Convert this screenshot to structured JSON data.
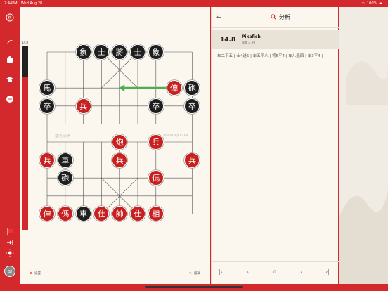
{
  "status": {
    "time": "7:44PM",
    "date": "Wed Aug 28",
    "battery": "100%"
  },
  "colors": {
    "accent": "#d4292c",
    "panel": "#fbf6ee"
  },
  "sidebar": {
    "icons": [
      "logo-icon",
      "analysis-icon",
      "puzzle-icon",
      "learn-icon",
      "chat-icon",
      "flag-icon",
      "logout-icon",
      "brightness-icon"
    ],
    "avatar": "ai"
  },
  "board": {
    "eval_label": "14.8",
    "eval_black_fraction": 0.17,
    "watermark_left": "楚河 漢界",
    "watermark_right": "XIANGQI.COM",
    "pieces": [
      {
        "c": "黑",
        "t": "象",
        "f": 2,
        "r": 0
      },
      {
        "c": "黑",
        "t": "士",
        "f": 3,
        "r": 0
      },
      {
        "c": "黑",
        "t": "將",
        "f": 4,
        "r": 0
      },
      {
        "c": "黑",
        "t": "士",
        "f": 5,
        "r": 0
      },
      {
        "c": "黑",
        "t": "象",
        "f": 6,
        "r": 0
      },
      {
        "c": "黑",
        "t": "馬",
        "f": 0,
        "r": 2
      },
      {
        "c": "紅",
        "t": "俥",
        "f": 7,
        "r": 2
      },
      {
        "c": "黑",
        "t": "砲",
        "f": 8,
        "r": 2
      },
      {
        "c": "黑",
        "t": "卒",
        "f": 0,
        "r": 3
      },
      {
        "c": "紅",
        "t": "兵",
        "f": 2,
        "r": 3
      },
      {
        "c": "黑",
        "t": "卒",
        "f": 6,
        "r": 3
      },
      {
        "c": "黑",
        "t": "卒",
        "f": 8,
        "r": 3
      },
      {
        "c": "紅",
        "t": "炮",
        "f": 4,
        "r": 5
      },
      {
        "c": "紅",
        "t": "兵",
        "f": 6,
        "r": 5
      },
      {
        "c": "紅",
        "t": "兵",
        "f": 0,
        "r": 6
      },
      {
        "c": "黑",
        "t": "車",
        "f": 1,
        "r": 6
      },
      {
        "c": "紅",
        "t": "兵",
        "f": 4,
        "r": 6
      },
      {
        "c": "紅",
        "t": "兵",
        "f": 8,
        "r": 6
      },
      {
        "c": "黑",
        "t": "砲",
        "f": 1,
        "r": 7
      },
      {
        "c": "紅",
        "t": "傌",
        "f": 6,
        "r": 7
      },
      {
        "c": "紅",
        "t": "俥",
        "f": 0,
        "r": 9
      },
      {
        "c": "紅",
        "t": "傌",
        "f": 1,
        "r": 9
      },
      {
        "c": "黑",
        "t": "車",
        "f": 2,
        "r": 9
      },
      {
        "c": "紅",
        "t": "仕",
        "f": 3,
        "r": 9
      },
      {
        "c": "紅",
        "t": "帥",
        "f": 4,
        "r": 9
      },
      {
        "c": "紅",
        "t": "仕",
        "f": 5,
        "r": 9
      },
      {
        "c": "紅",
        "t": "相",
        "f": 6,
        "r": 9
      }
    ],
    "arrow": {
      "from": [
        7,
        2
      ],
      "to": [
        4,
        2
      ]
    },
    "settings_label": "设置",
    "edit_label": "编辑"
  },
  "analysis": {
    "title": "分析",
    "score": "14.8",
    "engine": "Pikafish",
    "depth": "深度 = 20",
    "pv": "车二平五 | 士4进5 | 车五平八 | 将5平4 | 车八退四 | 车3平4 |",
    "nav_index": "0"
  }
}
